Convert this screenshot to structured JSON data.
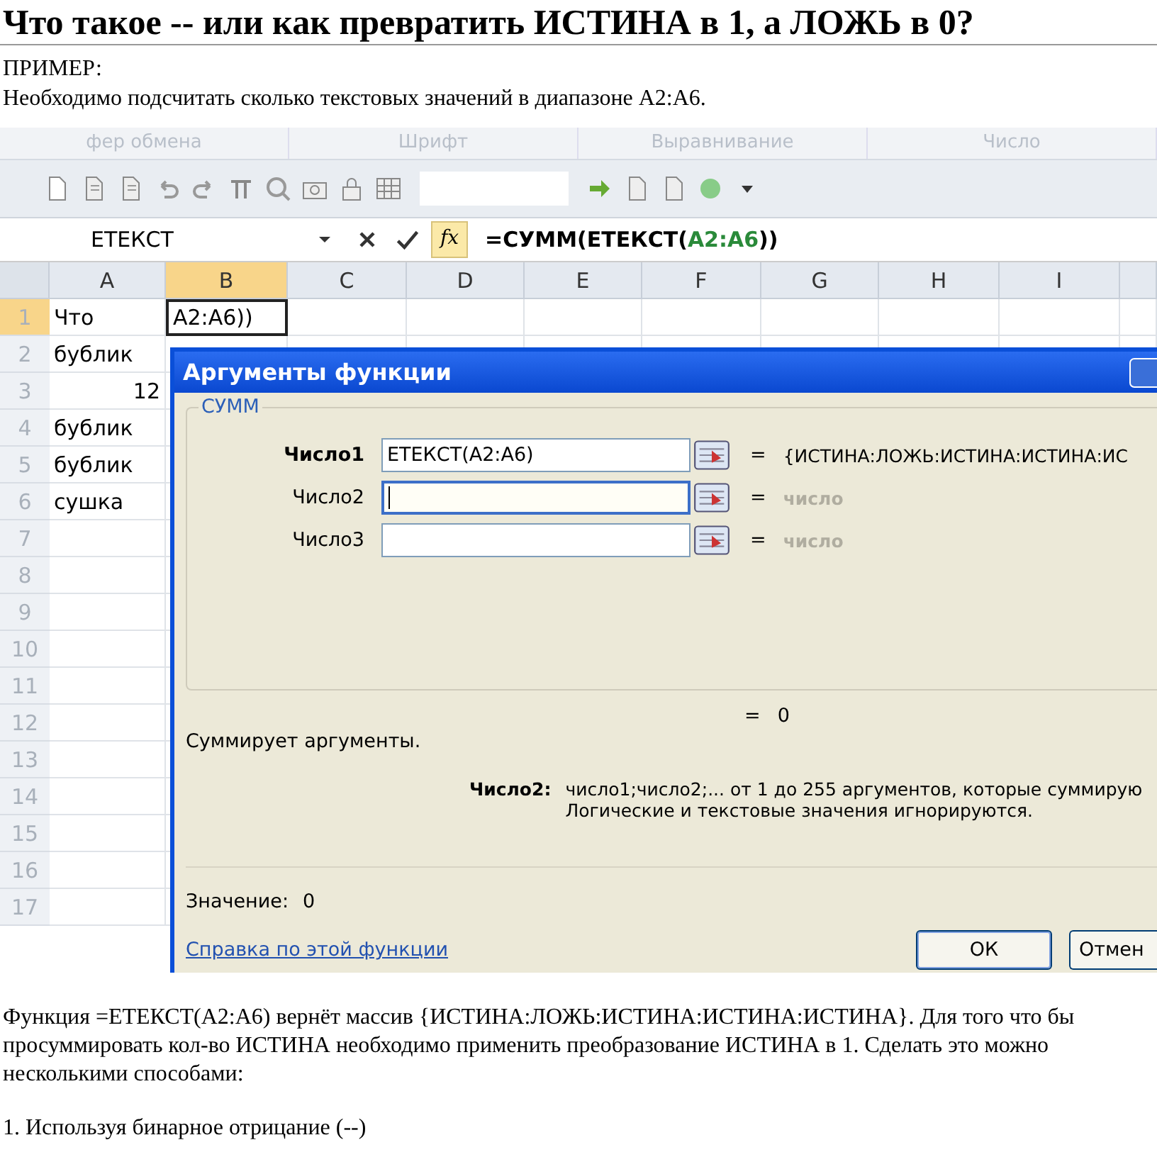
{
  "heading": "Что такое -- или как превратить ИСТИНА в 1, а ЛОЖЬ в 0?",
  "intro": [
    "ПРИМЕР:",
    "Необходимо подсчитать сколько текстовых значений в диапазоне A2:A6."
  ],
  "excel": {
    "ribbon_groups": [
      "фер обмена",
      "Шрифт",
      "Выравнивание",
      "Число"
    ],
    "name_box": "ЕТЕКСТ",
    "function_button": "fx",
    "formula": {
      "before": "=СУММ(ЕТЕКСТ(",
      "ref": "A2:A6",
      "after": "))"
    },
    "columns": [
      {
        "label": "A",
        "selected": false
      },
      {
        "label": "B",
        "selected": true
      },
      {
        "label": "C",
        "selected": false
      },
      {
        "label": "D",
        "selected": false
      },
      {
        "label": "E",
        "selected": false
      },
      {
        "label": "F",
        "selected": false
      },
      {
        "label": "G",
        "selected": false
      },
      {
        "label": "H",
        "selected": false
      },
      {
        "label": "I",
        "selected": false
      }
    ],
    "rows": [
      {
        "number": "1",
        "selected": true,
        "cells": [
          {
            "text": "Что",
            "kind": "text"
          },
          {
            "text": "A2:A6))",
            "kind": "editing"
          }
        ]
      },
      {
        "number": "2",
        "selected": false,
        "cells": [
          {
            "text": "бублик",
            "kind": "text"
          }
        ]
      },
      {
        "number": "3",
        "selected": false,
        "cells": [
          {
            "text": "12",
            "kind": "number"
          }
        ]
      },
      {
        "number": "4",
        "selected": false,
        "cells": [
          {
            "text": "бублик",
            "kind": "text"
          }
        ]
      },
      {
        "number": "5",
        "selected": false,
        "cells": [
          {
            "text": "бублик",
            "kind": "text"
          }
        ]
      },
      {
        "number": "6",
        "selected": false,
        "cells": [
          {
            "text": "сушка",
            "kind": "text"
          }
        ]
      },
      {
        "number": "7",
        "selected": false,
        "cells": []
      },
      {
        "number": "8",
        "selected": false,
        "cells": []
      },
      {
        "number": "9",
        "selected": false,
        "cells": []
      },
      {
        "number": "10",
        "selected": false,
        "cells": []
      },
      {
        "number": "11",
        "selected": false,
        "cells": []
      },
      {
        "number": "12",
        "selected": false,
        "cells": []
      },
      {
        "number": "13",
        "selected": false,
        "cells": []
      },
      {
        "number": "14",
        "selected": false,
        "cells": []
      },
      {
        "number": "15",
        "selected": false,
        "cells": []
      },
      {
        "number": "16",
        "selected": false,
        "cells": []
      },
      {
        "number": "17",
        "selected": false,
        "cells": []
      }
    ],
    "dialog": {
      "title": "Аргументы функции",
      "group_label": "СУММ",
      "args": [
        {
          "label": "Число1",
          "value": "ЕТЕКСТ(A2:A6)",
          "bold": true,
          "focused": false,
          "result": "{ИСТИНА:ЛОЖЬ:ИСТИНА:ИСТИНА:ИС",
          "muted": false
        },
        {
          "label": "Число2",
          "bold": false,
          "focused": true,
          "result": "число",
          "muted": true
        },
        {
          "label": "Число3",
          "bold": false,
          "focused": false,
          "result": "число",
          "muted": true
        }
      ],
      "equals": "=",
      "total": "0",
      "description": "Суммирует аргументы.",
      "help_label": "Число2:",
      "help_lines": [
        "число1;число2;... от 1 до 255 аргументов, которые суммирую",
        "Логические и текстовые значения игнорируются."
      ],
      "value_label": "Значение:",
      "value": "0",
      "help_link": "Справка по этой функции",
      "buttons": [
        "ОК",
        "Отмен"
      ]
    }
  },
  "paragraphs": [
    "Функция =ЕТЕКСТ(A2:A6) вернёт массив {ИСТИНА:ЛОЖЬ:ИСТИНА:ИСТИНА:ИСТИНА}. Для того что бы просуммировать кол-во ИСТИНА необходимо применить преобразование ИСТИНА в 1. Сделать это можно несколькими способами:",
    "1. Используя бинарное отрицание (--)"
  ]
}
